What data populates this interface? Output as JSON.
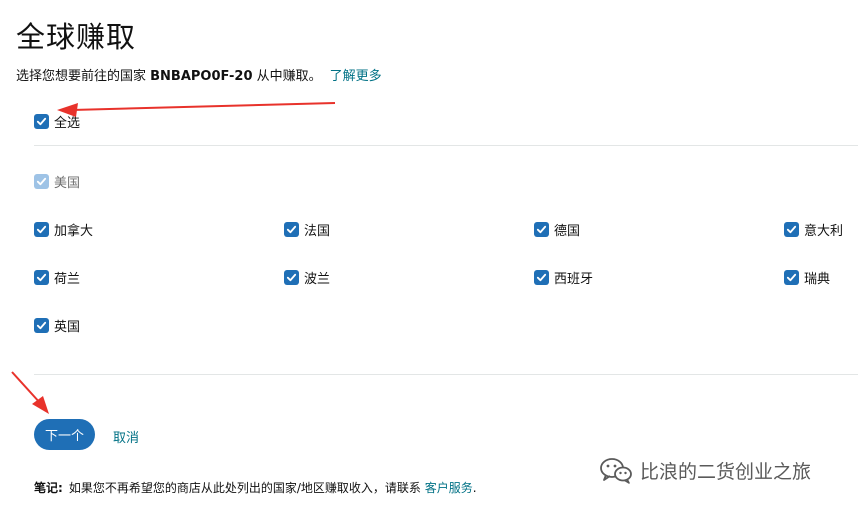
{
  "page": {
    "title": "全球赚取",
    "subtitle_prefix": "选择您想要前往的国家 ",
    "subtitle_code": "BNBAPO0F-20",
    "subtitle_suffix": " 从中赚取。",
    "learn_more": "了解更多"
  },
  "select_all": {
    "label": "全选",
    "checked": true
  },
  "home_country": {
    "label": "美国",
    "checked": true,
    "disabled": true
  },
  "countries": [
    {
      "label": "加拿大",
      "checked": true
    },
    {
      "label": "法国",
      "checked": true
    },
    {
      "label": "德国",
      "checked": true
    },
    {
      "label": "意大利",
      "checked": true
    },
    {
      "label": "荷兰",
      "checked": true
    },
    {
      "label": "波兰",
      "checked": true
    },
    {
      "label": "西班牙",
      "checked": true
    },
    {
      "label": "瑞典",
      "checked": true
    },
    {
      "label": "英国",
      "checked": true
    }
  ],
  "actions": {
    "next": "下一个",
    "cancel": "取消"
  },
  "note": {
    "label": "笔记:",
    "text": "如果您不再希望您的商店从此处列出的国家/地区赚取收入，请联系 ",
    "link": "客户服务",
    "end": "."
  },
  "watermark": {
    "text": "比浪的二货创业之旅",
    "icon": "wechat-icon"
  },
  "colors": {
    "accent": "#1f6fb6",
    "link": "#007185",
    "annotation_arrow": "#e8322b"
  }
}
